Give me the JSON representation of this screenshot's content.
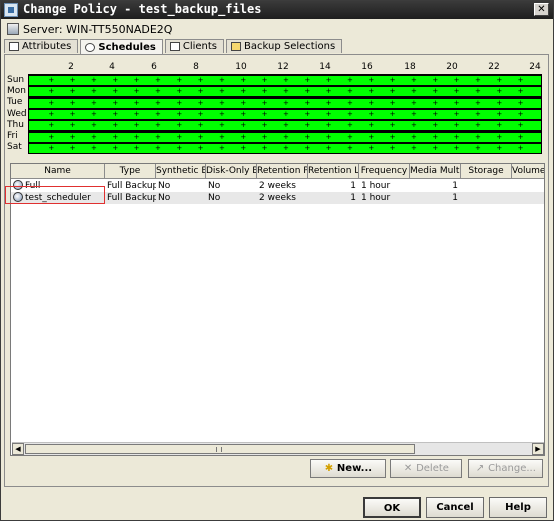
{
  "window": {
    "title": "Change Policy - test_backup_files",
    "close_label": "✕"
  },
  "server": {
    "label": "Server: WIN-TT550NADE2Q"
  },
  "tabs": [
    {
      "label": "Attributes",
      "active": false
    },
    {
      "label": "Schedules",
      "active": true
    },
    {
      "label": "Clients",
      "active": false
    },
    {
      "label": "Backup Selections",
      "active": false
    }
  ],
  "schedule_grid": {
    "hours": [
      "2",
      "4",
      "6",
      "8",
      "10",
      "12",
      "14",
      "16",
      "18",
      "20",
      "22",
      "24"
    ],
    "days": [
      "Sun",
      "Mon",
      "Tue",
      "Wed",
      "Thu",
      "Fri",
      "Sat"
    ],
    "window_color": "#00ff00",
    "tick_mark": "+"
  },
  "table": {
    "columns": [
      "Name",
      "Type",
      "Synthetic B...",
      "Disk-Only B...",
      "Retention P...",
      "Retention L...",
      "Frequency",
      "Media Multi...",
      "Storage",
      "Volume"
    ],
    "rows": [
      {
        "name": "Full",
        "type": "Full Backup",
        "synthetic": "No",
        "disk_only": "No",
        "retention_period": "2 weeks",
        "retention_level": "1",
        "frequency": "1 hour",
        "media_multiplexing": "1",
        "storage": "",
        "volume": ""
      },
      {
        "name": "test_scheduler",
        "type": "Full Backup",
        "synthetic": "No",
        "disk_only": "No",
        "retention_period": "2 weeks",
        "retention_level": "1",
        "frequency": "1 hour",
        "media_multiplexing": "1",
        "storage": "",
        "volume": ""
      }
    ]
  },
  "actions": {
    "new": "New...",
    "delete": "Delete",
    "change": "Change..."
  },
  "dialog_buttons": {
    "ok": "OK",
    "cancel": "Cancel",
    "help": "Help"
  },
  "colors": {
    "title_bar": "#2a2a2a",
    "highlight_box": "#e03030"
  }
}
